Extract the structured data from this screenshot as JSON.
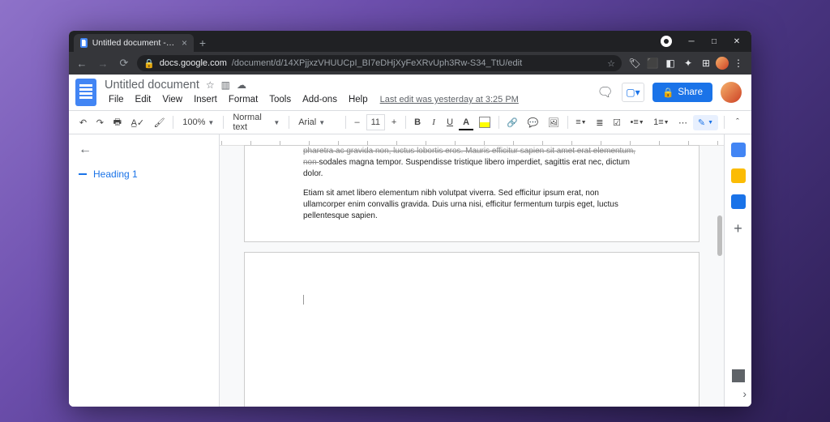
{
  "browser": {
    "tab": {
      "title": "Untitled document - Google Do",
      "close": "×"
    },
    "new_tab": "+",
    "nav": {
      "back": "←",
      "forward": "→",
      "reload": "⟳"
    },
    "url_domain": "docs.google.com",
    "url_path": "/document/d/14XPjjxzVHUUCpI_BI7eDHjXyFeXRvUph3Rw-S34_TtU/edit",
    "star": "☆"
  },
  "docs": {
    "title": "Untitled document",
    "menu": {
      "file": "File",
      "edit": "Edit",
      "view": "View",
      "insert": "Insert",
      "format": "Format",
      "tools": "Tools",
      "addons": "Add-ons",
      "help": "Help"
    },
    "last_edit": "Last edit was yesterday at 3:25 PM",
    "share": "Share"
  },
  "toolbar": {
    "zoom": "100%",
    "styles": "Normal text",
    "font": "Arial",
    "size_minus": "–",
    "size": "11",
    "size_plus": "+",
    "bold": "B",
    "italic": "I",
    "underline": "U",
    "textcolor": "A"
  },
  "outline": {
    "items": [
      {
        "label": "Heading 1"
      }
    ]
  },
  "document": {
    "page1": {
      "line1": "pharetra ac gravida non, luctus lobortis eros. Mauris efficitur sapien sit amet erat elementum, non ",
      "line2": "sodales magna tempor. Suspendisse tristique libero imperdiet, sagittis erat nec, dictum dolor.",
      "para2": "Etiam sit amet libero elementum nibh volutpat viverra. Sed efficitur ipsum erat, non ullamcorper enim convallis gravida. Duis urna nisi, efficitur fermentum turpis eget, luctus pellentesque sapien."
    }
  }
}
